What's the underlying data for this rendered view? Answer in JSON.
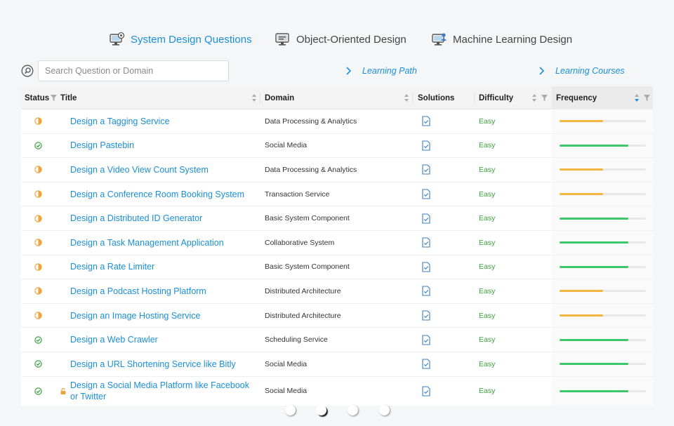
{
  "tabs": [
    {
      "label": "System Design Questions",
      "icon": "monitor-gear-icon",
      "active": true
    },
    {
      "label": "Object-Oriented Design",
      "icon": "monitor-icon",
      "active": false
    },
    {
      "label": "Machine Learning Design",
      "icon": "monitor-person-icon",
      "active": false
    }
  ],
  "search": {
    "placeholder": "Search Question or Domain",
    "value": ""
  },
  "links": {
    "learning_path": "Learning Path",
    "learning_courses": "Learning Courses"
  },
  "columns": {
    "status": "Status",
    "title": "Title",
    "domain": "Domain",
    "solutions": "Solutions",
    "difficulty": "Difficulty",
    "frequency": "Frequency"
  },
  "colors": {
    "accent": "#1a8fd8",
    "in_progress": "#f0a33a",
    "done": "#3aa13c",
    "freq_high": "#3cc76a",
    "freq_mid": "#f4b63e"
  },
  "rows": [
    {
      "status": "in-progress",
      "title": "Design a Tagging Service",
      "domain": "Data Processing & Analytics",
      "difficulty": "Easy",
      "frequency": 0.5,
      "freq_color": "mid"
    },
    {
      "status": "done",
      "title": "Design Pastebin",
      "domain": "Social Media",
      "difficulty": "Easy",
      "frequency": 0.8,
      "freq_color": "high"
    },
    {
      "status": "in-progress",
      "title": "Design a Video View Count System",
      "domain": "Data Processing & Analytics",
      "difficulty": "Easy",
      "frequency": 0.5,
      "freq_color": "mid"
    },
    {
      "status": "in-progress",
      "title": "Design a Conference Room Booking System",
      "domain": "Transaction Service",
      "difficulty": "Easy",
      "frequency": 0.5,
      "freq_color": "mid"
    },
    {
      "status": "in-progress",
      "title": "Design a Distributed ID Generator",
      "domain": "Basic System Component",
      "difficulty": "Easy",
      "frequency": 0.8,
      "freq_color": "high"
    },
    {
      "status": "in-progress",
      "title": "Design a Task Management Application",
      "domain": "Collaborative System",
      "difficulty": "Easy",
      "frequency": 0.8,
      "freq_color": "high"
    },
    {
      "status": "in-progress",
      "title": "Design a Rate Limiter",
      "domain": "Basic System Component",
      "difficulty": "Easy",
      "frequency": 0.8,
      "freq_color": "high"
    },
    {
      "status": "in-progress",
      "title": "Design a Podcast Hosting Platform",
      "domain": "Distributed Architecture",
      "difficulty": "Easy",
      "frequency": 0.5,
      "freq_color": "mid"
    },
    {
      "status": "in-progress",
      "title": "Design an Image Hosting Service",
      "domain": "Distributed Architecture",
      "difficulty": "Easy",
      "frequency": 0.5,
      "freq_color": "mid"
    },
    {
      "status": "done",
      "title": "Design a Web Crawler",
      "domain": "Scheduling Service",
      "difficulty": "Easy",
      "frequency": 0.8,
      "freq_color": "high"
    },
    {
      "status": "done",
      "title": "Design a URL Shortening Service like Bitly",
      "domain": "Social Media",
      "difficulty": "Easy",
      "frequency": 0.8,
      "freq_color": "high"
    },
    {
      "status": "done",
      "title": "Design a Social Media Platform like Facebook or Twitter",
      "domain": "Social Media",
      "difficulty": "Easy",
      "frequency": 0.8,
      "freq_color": "high",
      "locked": true
    }
  ],
  "pagination": {
    "count": 4,
    "active_index": 1
  }
}
